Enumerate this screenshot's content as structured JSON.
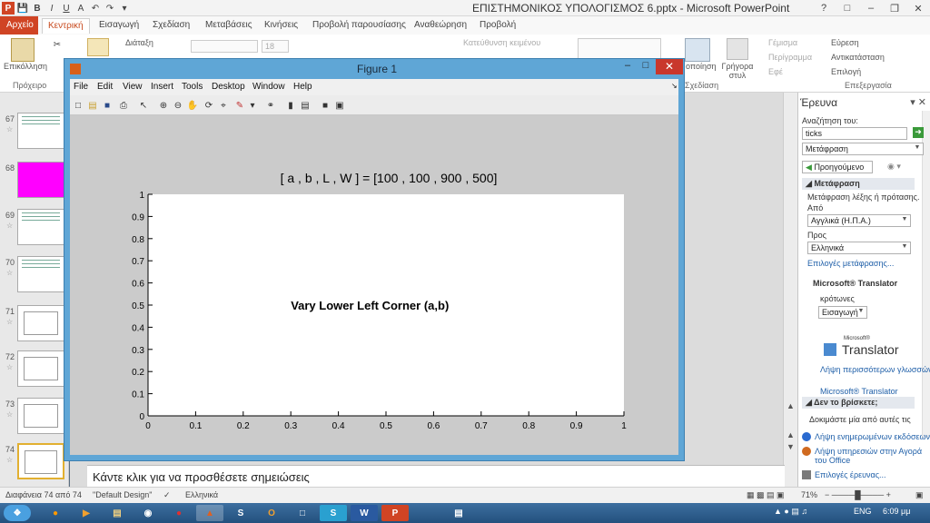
{
  "powerpoint": {
    "title": "ΕΠΙΣΤΗΜΟΝΙΚΟΣ ΥΠΟΛΟΓΙΣΜΟΣ 6.pptx - Microsoft PowerPoint",
    "tabs": [
      "Αρχείο",
      "Κεντρική",
      "Εισαγωγή",
      "Σχεδίαση",
      "Μεταβάσεις",
      "Κινήσεις",
      "Προβολή παρουσίασης",
      "Αναθεώρηση",
      "Προβολή"
    ],
    "ribbon": {
      "paste_label": "Επικόλληση",
      "clipboard_group": "Πρόχειρο",
      "layout_label": "Διάταξη",
      "font_size": "18",
      "text_direction": "Κατεύθυνση κειμένου",
      "presentation_label": "οποίηση",
      "quick_styles": "Γρήγορα στυλ",
      "fill": "Γέμισμα",
      "outline": "Περίγραμμα",
      "effects": "Εφέ",
      "find": "Εύρεση",
      "replace": "Αντικατάσταση",
      "select": "Επιλογή",
      "editing_group": "Επεξεργασία",
      "drawing_group": "Σχεδίαση"
    },
    "slides": [
      {
        "num": "67"
      },
      {
        "num": "68"
      },
      {
        "num": "69"
      },
      {
        "num": "70"
      },
      {
        "num": "71"
      },
      {
        "num": "72"
      },
      {
        "num": "73"
      },
      {
        "num": "74"
      }
    ],
    "notes_placeholder": "Κάντε κλικ για να προσθέσετε σημειώσεις",
    "status": {
      "slide_info": "Διαφάνεια 74 από 74",
      "theme": "\"Default Design\"",
      "language": "Ελληνικά",
      "zoom": "71%"
    },
    "taskbar": {
      "time": "6:09 μμ",
      "lang": "ENG"
    }
  },
  "research": {
    "title": "Έρευνα",
    "search_for_label": "Αναζήτηση του:",
    "search_value": "ticks",
    "service": "Μετάφραση",
    "back_button": "Προηγούμενο",
    "translation_section": "Μετάφραση",
    "translate_desc": "Μετάφραση λέξης ή πρότασης.",
    "from_label": "Από",
    "from_value": "Αγγλικά (Η.Π.Α.)",
    "to_label": "Προς",
    "to_value": "Ελληνικά",
    "options_link": "Επιλογές μετάφρασης...",
    "ms_translator": "Microsoft® Translator",
    "result_word": "κρότωνες",
    "insert_button": "Εισαγωγή",
    "translator_logo_small": "Microsoft®",
    "translator_logo": "Translator",
    "more_languages": "Λήψη περισσότερων γλωσσών",
    "ms_translator_link": "Microsoft® Translator",
    "not_found_section": "Δεν το βρίσκετε;",
    "not_found_text": "Δοκιμάστε μία από αυτές τις",
    "update_link": "Λήψη ενημερωμένων εκδόσεων γι",
    "office_store_link": "Λήψη υπηρεσιών στην Αγορά του Office",
    "research_options": "Επιλογές έρευνας..."
  },
  "figure": {
    "title": "Figure 1",
    "menu": [
      "File",
      "Edit",
      "View",
      "Insert",
      "Tools",
      "Desktop",
      "Window",
      "Help"
    ],
    "plot_title": "[ a , b , L , W ]  =  [100 , 100 , 900 , 500]",
    "annotation": "Vary Lower Left Corner (a,b)",
    "colors": {
      "titlebar": "#5fa6d6",
      "close": "#c9372c",
      "figure_bg": "#cbcbcb"
    }
  },
  "chart_data": {
    "type": "scatter",
    "title": "[ a , b , L , W ]  =  [100 , 100 , 900 , 500]",
    "xlabel": "",
    "ylabel": "",
    "xlim": [
      0,
      1
    ],
    "ylim": [
      0,
      1
    ],
    "xticks": [
      "0",
      "0.1",
      "0.2",
      "0.3",
      "0.4",
      "0.5",
      "0.6",
      "0.7",
      "0.8",
      "0.9",
      "1"
    ],
    "yticks": [
      "0",
      "0.1",
      "0.2",
      "0.3",
      "0.4",
      "0.5",
      "0.6",
      "0.7",
      "0.8",
      "0.9",
      "1"
    ],
    "series": [],
    "annotations": [
      {
        "text": "Vary Lower Left Corner (a,b)",
        "x": 0.3,
        "y": 0.5
      }
    ],
    "grid": false
  }
}
